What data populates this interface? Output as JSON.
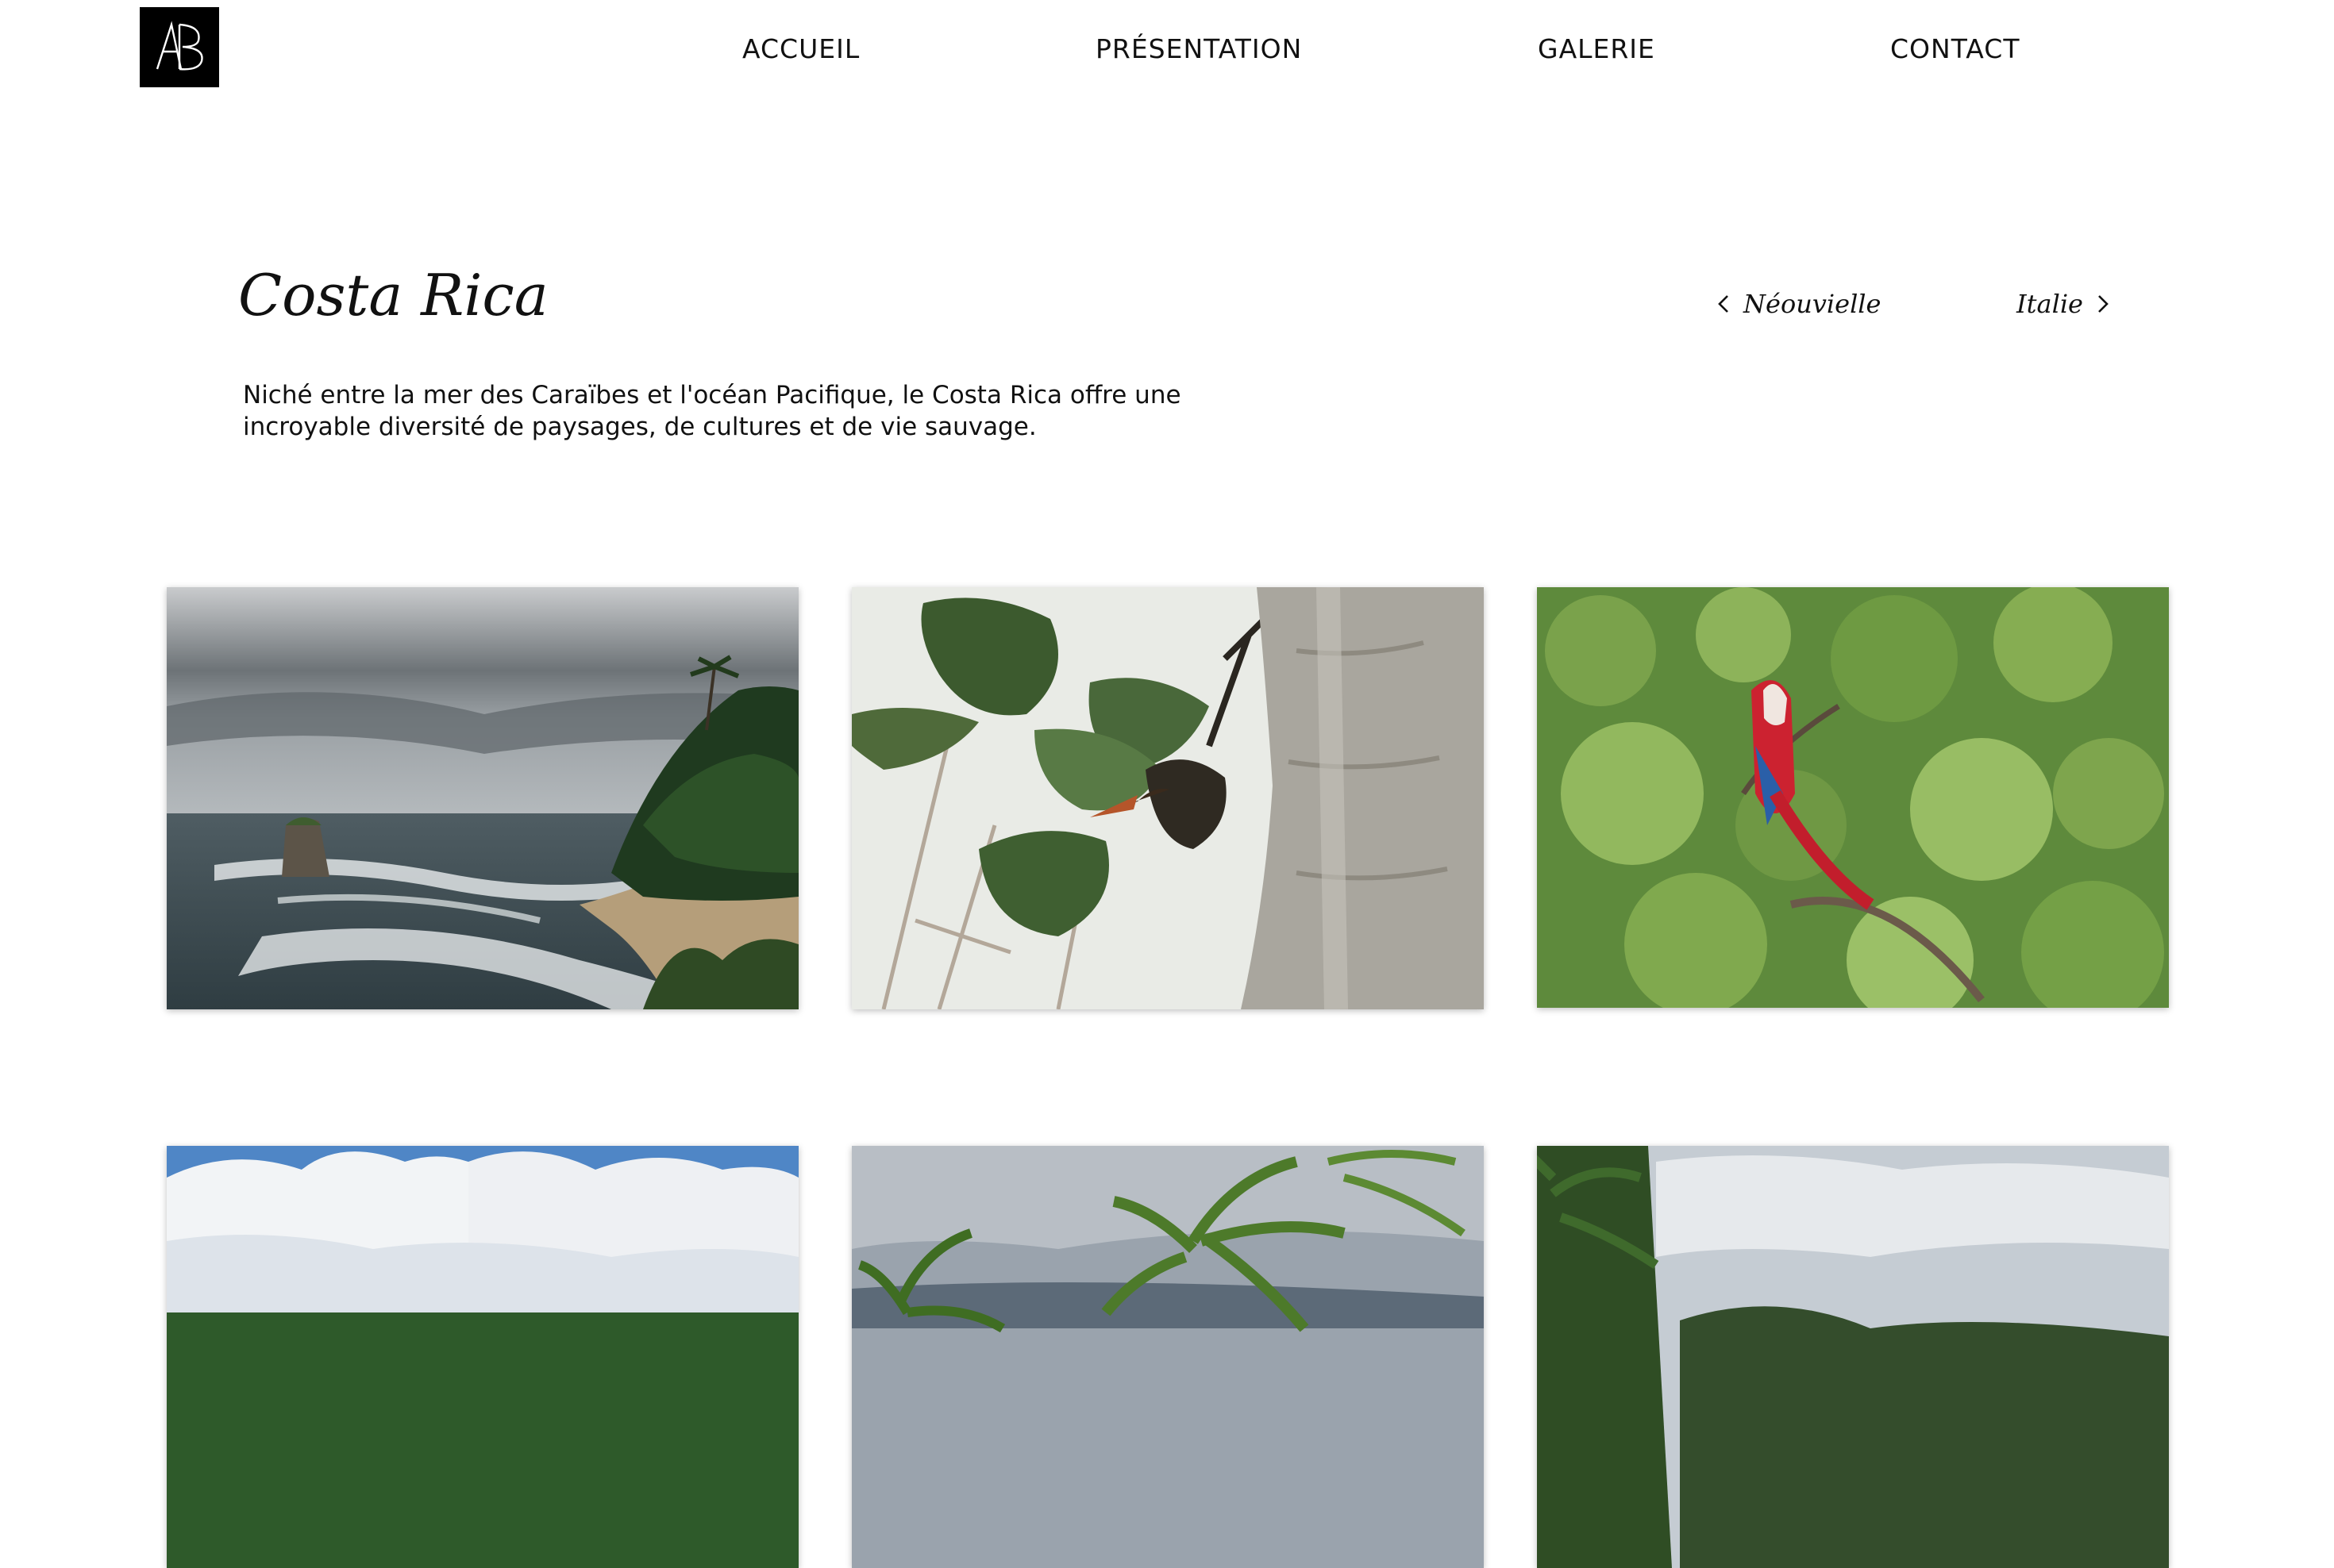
{
  "logo": {
    "icon": "ab-monogram-logo",
    "text": "AB"
  },
  "nav": {
    "items": [
      {
        "label": "ACCUEIL"
      },
      {
        "label": "PRÉSENTATION"
      },
      {
        "label": "GALERIE"
      },
      {
        "label": "CONTACT"
      }
    ]
  },
  "page": {
    "title": "Costa Rica",
    "description": "Niché entre la mer des Caraïbes et l'océan Pacifique, le Costa Rica offre une incroyable diversité de paysages, de cultures et de vie sauvage."
  },
  "pager": {
    "prev_label": "Néouvielle",
    "next_label": "Italie"
  },
  "gallery": {
    "photos": [
      {
        "subject": "stormy-coast-photo"
      },
      {
        "subject": "toucan-in-tree-photo"
      },
      {
        "subject": "scarlet-macaw-photo"
      },
      {
        "subject": "palm-shoreline-sky-photo"
      },
      {
        "subject": "palm-fronds-sky-photo"
      },
      {
        "subject": "jungle-clouds-photo"
      }
    ]
  },
  "colors": {
    "background": "#ffffff",
    "text": "#111111",
    "logo_bg": "#000000"
  }
}
